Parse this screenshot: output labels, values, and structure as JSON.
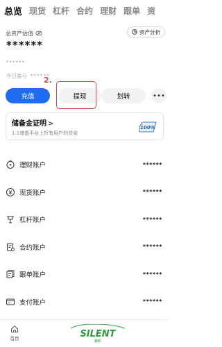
{
  "tabs": [
    "总览",
    "现货",
    "杠杆",
    "合约",
    "理财",
    "跟单",
    "资"
  ],
  "asset": {
    "label": "总资产估值",
    "value": "******",
    "sub": "******",
    "analysis_label": "资产分析"
  },
  "today": {
    "label": "今日盈亏",
    "value": "******"
  },
  "actions": {
    "deposit": "充值",
    "withdraw": "提现",
    "transfer": "划转",
    "more": "•••"
  },
  "annotation": {
    "step": "2."
  },
  "reserve": {
    "title": "储备金证明",
    "arrow": ">",
    "subtitle": "1:1储备平台上所有用户的资金",
    "badge": "100%"
  },
  "accounts": [
    {
      "name": "理财账户",
      "value": "******",
      "icon": "finance-icon"
    },
    {
      "name": "现货账户",
      "value": "******",
      "icon": "spot-icon"
    },
    {
      "name": "杠杆账户",
      "value": "******",
      "icon": "margin-icon"
    },
    {
      "name": "合约账户",
      "value": "******",
      "icon": "futures-icon"
    },
    {
      "name": "跟单账户",
      "value": "******",
      "icon": "copy-trade-icon"
    },
    {
      "name": "支付账户",
      "value": "******",
      "icon": "pay-icon"
    }
  ],
  "bottom_nav": {
    "home_label": "首页"
  },
  "watermark": {
    "text": "SILENT",
    "sub": "静影"
  },
  "colors": {
    "primary": "#1f6cf2",
    "annotation": "#d2473f",
    "badge": "#1f5fb4"
  }
}
